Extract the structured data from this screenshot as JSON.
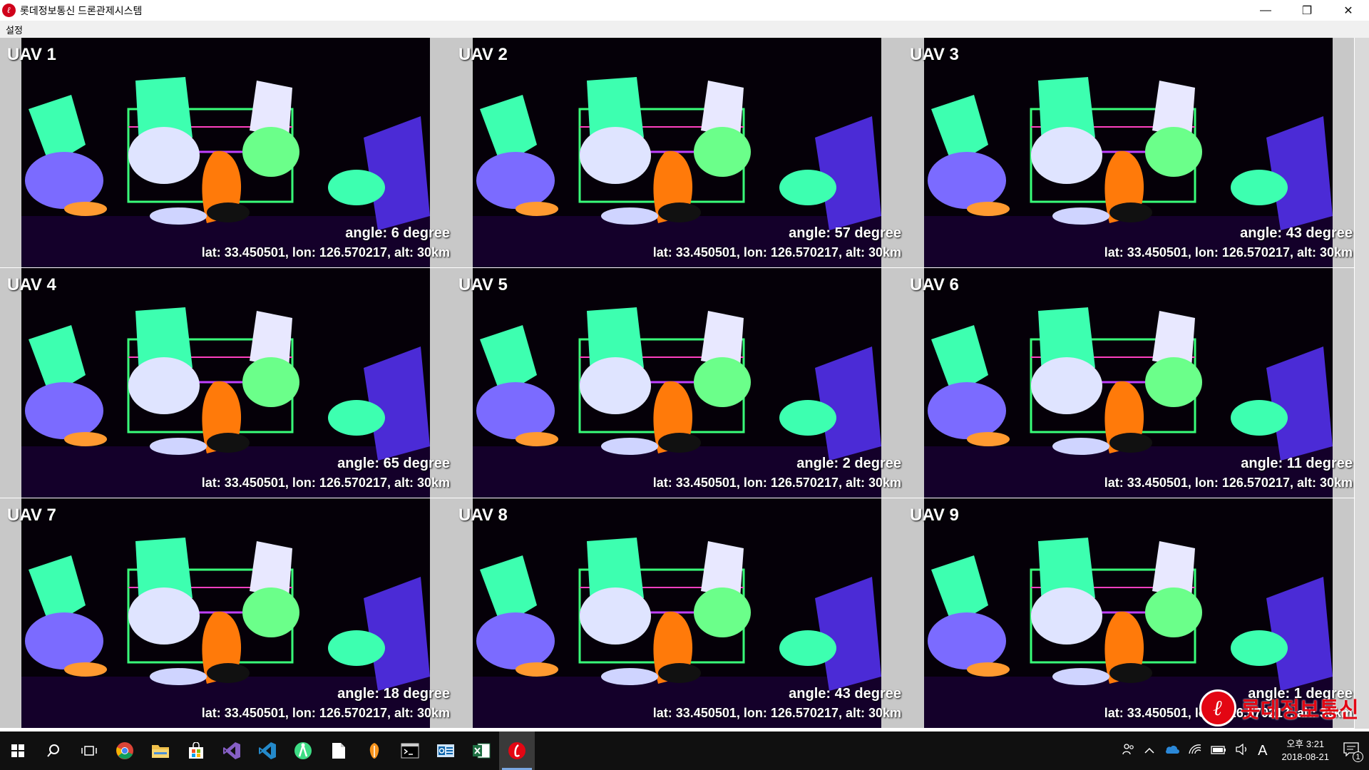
{
  "window": {
    "title": "롯데정보통신 드론관제시스템",
    "icon": "lotte-logo-icon",
    "controls": {
      "minimize": "—",
      "maximize": "❐",
      "close": "✕"
    }
  },
  "menu": {
    "items": [
      "설정"
    ]
  },
  "uavs": [
    {
      "label": "UAV 1",
      "angle": "angle: 6 degree",
      "coords": "lat: 33.450501, lon: 126.570217, alt: 30km"
    },
    {
      "label": "UAV 2",
      "angle": "angle: 57 degree",
      "coords": "lat: 33.450501, lon: 126.570217, alt: 30km"
    },
    {
      "label": "UAV 3",
      "angle": "angle: 43 degree",
      "coords": "lat: 33.450501, lon: 126.570217, alt: 30km"
    },
    {
      "label": "UAV 4",
      "angle": "angle: 65 degree",
      "coords": "lat: 33.450501, lon: 126.570217, alt: 30km"
    },
    {
      "label": "UAV 5",
      "angle": "angle: 2 degree",
      "coords": "lat: 33.450501, lon: 126.570217, alt: 30km"
    },
    {
      "label": "UAV 6",
      "angle": "angle: 11 degree",
      "coords": "lat: 33.450501, lon: 126.570217, alt: 30km"
    },
    {
      "label": "UAV 7",
      "angle": "angle: 18 degree",
      "coords": "lat: 33.450501, lon: 126.570217, alt: 30km"
    },
    {
      "label": "UAV 8",
      "angle": "angle: 43 degree",
      "coords": "lat: 33.450501, lon: 126.570217, alt: 30km"
    },
    {
      "label": "UAV 9",
      "angle": "angle: 1 degree",
      "coords": "lat: 33.450501, lon: 126.570217, alt: 30km"
    }
  ],
  "watermark": {
    "text": "롯데정보통신",
    "color": "#e30613"
  },
  "taskbar": {
    "apps": [
      "windows-start-icon",
      "search-icon",
      "task-view-icon",
      "chrome-icon",
      "file-explorer-icon",
      "store-icon",
      "visual-studio-icon",
      "vscode-icon",
      "android-studio-icon",
      "document-icon",
      "fl-studio-icon",
      "terminal-icon",
      "outlook-icon",
      "excel-icon",
      "lotte-app-icon"
    ],
    "tray": {
      "input_indicator": "A",
      "notification_count": "1"
    },
    "clock": {
      "time": "오후 3:21",
      "date": "2018-08-21"
    }
  }
}
